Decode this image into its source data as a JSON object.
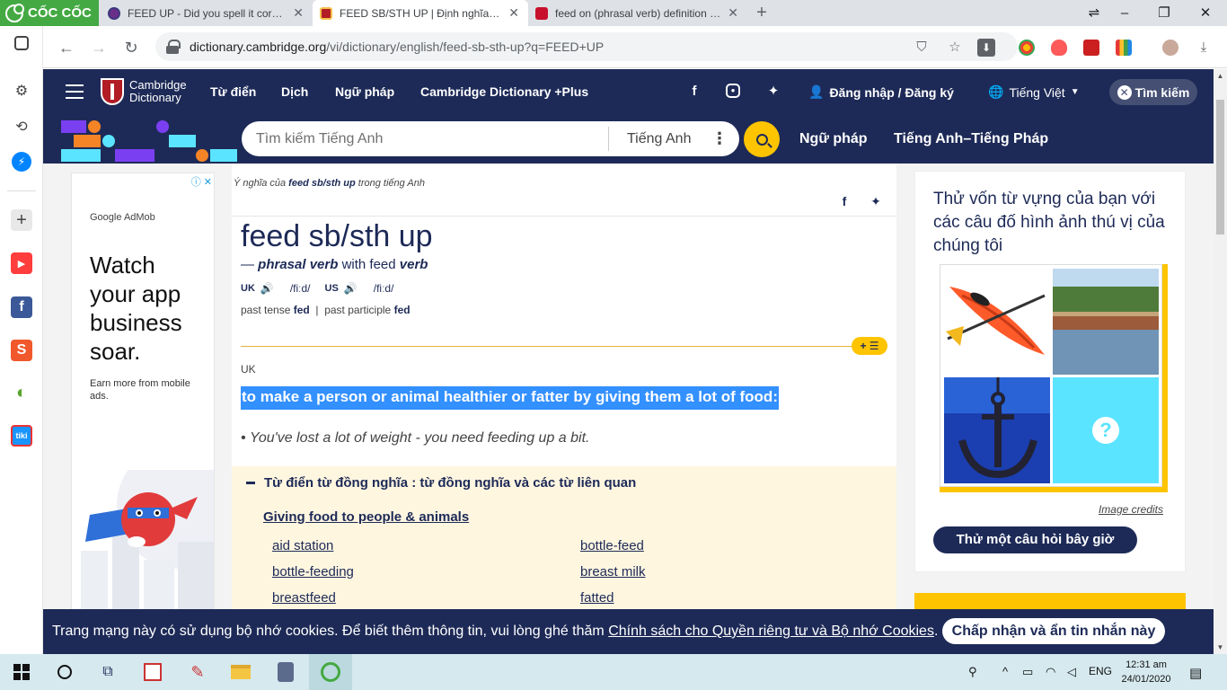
{
  "browser": {
    "brand": "CỐC CỐC",
    "tabs": [
      {
        "title": "FEED UP - Did you spell it correctly",
        "active": false
      },
      {
        "title": "FEED SB/STH UP | Định nghĩa trong",
        "active": true
      },
      {
        "title": "feed on (phrasal verb) definition an",
        "active": false
      }
    ],
    "url_host": "dictionary.cambridge.org",
    "url_path": "/vi/dictionary/english/feed-sb-sth-up?q=FEED+UP"
  },
  "header": {
    "logo_line1": "Cambridge",
    "logo_line2": "Dictionary",
    "nav": [
      "Từ điển",
      "Dịch",
      "Ngữ pháp",
      "Cambridge Dictionary +Plus"
    ],
    "login": "Đăng nhập / Đăng ký",
    "language": "Tiếng Việt",
    "search_toggle": "Tìm kiếm"
  },
  "search": {
    "placeholder": "Tìm kiếm Tiếng Anh",
    "dictionary": "Tiếng Anh",
    "links": [
      "Ngữ pháp",
      "Tiếng Anh–Tiếng Pháp"
    ]
  },
  "ad": {
    "brand": "AdMob",
    "brand_prefix": "Google",
    "headline": "Watch your app business soar.",
    "sub": "Earn more from mobile ads."
  },
  "entry": {
    "crumb_prefix": "Ý nghĩa của",
    "crumb_word": "feed sb/sth up",
    "crumb_suffix": "trong tiếng Anh",
    "headword": "feed sb/sth up",
    "pos_dash": "—",
    "pos": "phrasal verb",
    "with_text": "with feed",
    "with_pos": "verb",
    "uk_label": "UK",
    "uk_ipa": "/fiːd/",
    "us_label": "US",
    "us_ipa": "/fiːd/",
    "past_tense_label": "past tense",
    "past_tense": "fed",
    "separator": "|",
    "past_participle_label": "past participle",
    "past_participle": "fed",
    "plus_label": "+ ☰",
    "region": "UK",
    "definition": "to make a person or animal healthier or fatter by giving them a lot of food:",
    "example": "You've lost a lot of weight - you need feeding up a bit."
  },
  "thesaurus": {
    "title": "Từ điển từ đồng nghĩa : từ đồng nghĩa và các từ liên quan",
    "category": "Giving food to people & animals",
    "words": [
      "aid station",
      "bottle-feed",
      "bottle-feeding",
      "breast milk",
      "breastfeed",
      "fatted"
    ]
  },
  "quiz": {
    "title": "Thử vốn từ vựng của bạn với các câu đố hình ảnh thú vị của chúng tôi",
    "credits": "Image credits",
    "button": "Thử một câu hỏi bây giờ",
    "unknown_mark": "?"
  },
  "cookie": {
    "text": "Trang mạng này có sử dụng bộ nhớ cookies. Để biết thêm thông tin, vui lòng ghé thăm ",
    "link": "Chính sách cho Quyền riêng tư và Bộ nhớ Cookies",
    "end": ".",
    "button": "Chấp nhận và ẩn tin nhắn này"
  },
  "taskbar": {
    "lang": "ENG",
    "time": "12:31 am",
    "date": "24/01/2020"
  },
  "colors": {
    "brand_navy": "#1d2a57",
    "accent_yellow": "#fec400",
    "selection_blue": "#3390ff",
    "thesaurus_bg": "#fff6e0",
    "coccoc_green": "#44a942"
  }
}
